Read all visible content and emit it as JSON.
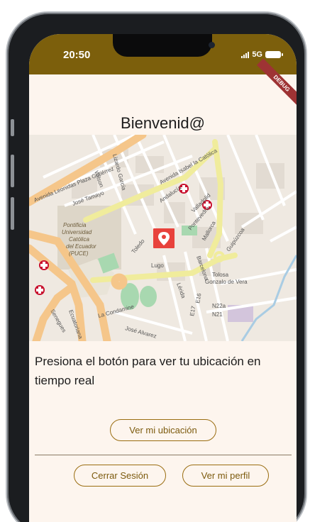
{
  "status_bar": {
    "time": "20:50",
    "network": "5G"
  },
  "debug_banner": "DEBUG",
  "page": {
    "title": "Bienvenid@",
    "info_text": "Presiona el botón para ver tu ubicación en tiempo real"
  },
  "map": {
    "labels": {
      "avenida": "Avenida Isabel la Católica",
      "university": [
        "Pontificia",
        "Universidad",
        "Católica",
        "del Ecuador",
        "(PUCE)"
      ],
      "lugo": "Lugo",
      "toledo": "Toledo",
      "tolosa": "Tolosa",
      "gonzalo": "Gonzalo de Vera",
      "lacondamine": "La Condamine",
      "josealvarez": "José Alvarez",
      "mallorca": "Mallorca",
      "valladolid": "Valladolid",
      "pontevedra": "Pontevedra",
      "andalucia": "Andalucía",
      "guipuzcoa": "Guipúzcoa",
      "wilson": "Wilson",
      "lizardo": "Lizardo García",
      "leonidas": "Avenida Leonidas Plaza Gutiérrez",
      "josetamayo": "José Tamayo",
      "n22a": "N22a",
      "n21": "N21",
      "e16": "E16",
      "e17": "E17",
      "lerida": "Lérida",
      "barcelona": "Barcelona",
      "ecuatoriana": "Ecuatoriana",
      "senegues": "Senegues"
    }
  },
  "buttons": {
    "ver_ubicacion": "Ver mi ubicación",
    "cerrar_sesion": "Cerrar Sesión",
    "ver_perfil": "Ver mi perfil"
  },
  "colors": {
    "appbar": "#7c5f0c",
    "marker": "#e8423c",
    "accent": "#9a6d10",
    "background": "#fdf5ee"
  }
}
